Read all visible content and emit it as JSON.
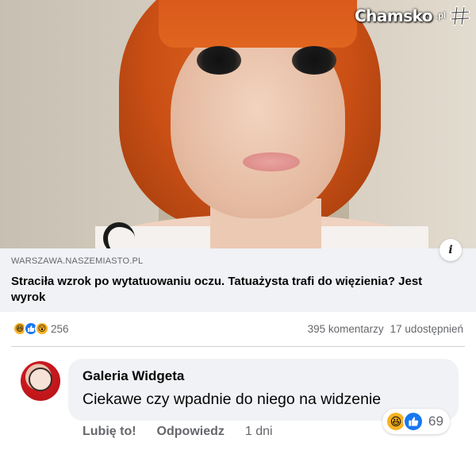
{
  "watermark": {
    "text": "Chamsko",
    "suffix": ".pl",
    "icon": "hashtag-logo"
  },
  "link_preview": {
    "domain": "WARSZAWA.NASZEMIASTO.PL",
    "headline": "Straciła wzrok po wytatuowaniu oczu. Tatuażysta trafi do więzienia? Jest wyrok",
    "info_icon": "info-icon"
  },
  "summary": {
    "reaction_icons": [
      "haha-icon",
      "like-icon",
      "wow-icon"
    ],
    "reaction_count": "256",
    "comments": "395 komentarzy",
    "shares": "17 udostępnień"
  },
  "comment": {
    "author": "Galeria Widgeta",
    "text": "Ciekawe czy wpadnie do niego na widzenie",
    "reaction_icons": [
      "haha-icon",
      "like-icon"
    ],
    "reaction_count": "69",
    "actions": {
      "like": "Lubię to!",
      "reply": "Odpowiedz",
      "time": "1 dni"
    }
  },
  "colors": {
    "accent": "#1877f2",
    "muted": "#65676b",
    "bubble": "#f0f2f5"
  }
}
